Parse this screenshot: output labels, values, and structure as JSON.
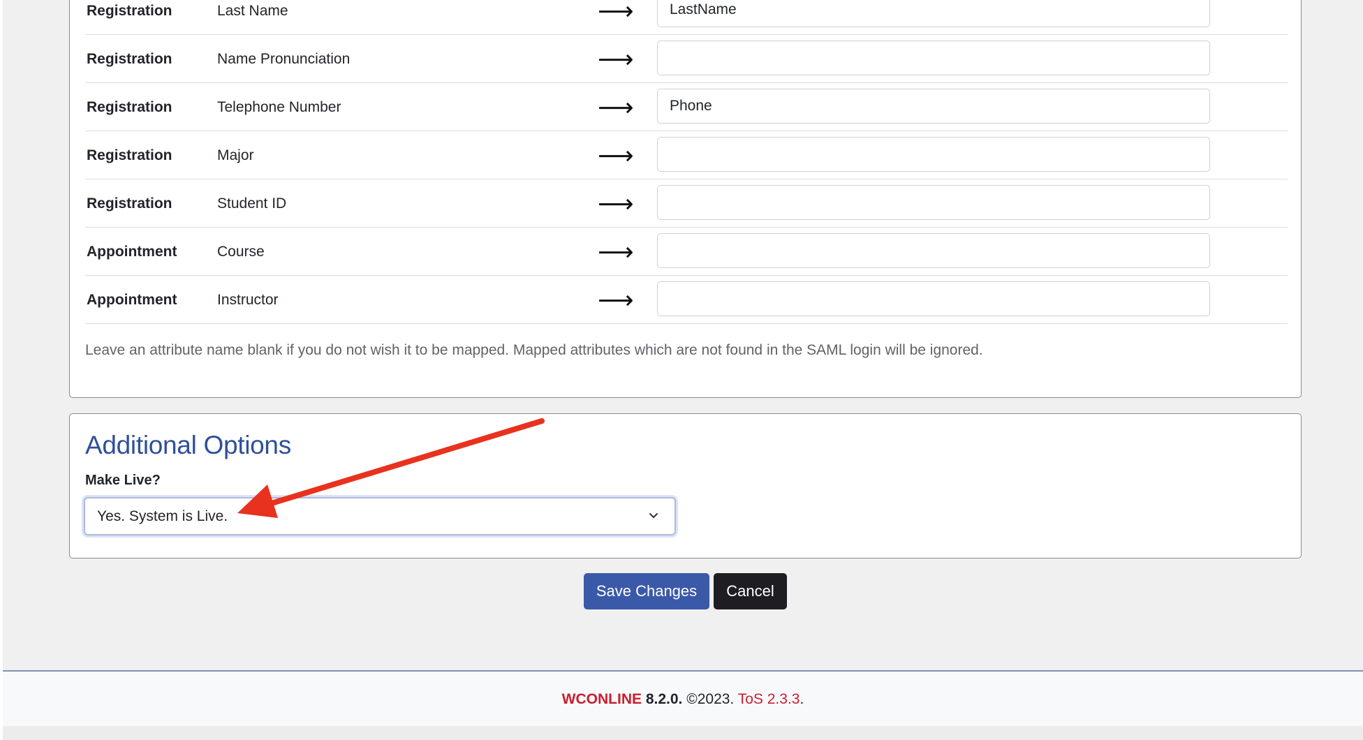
{
  "attribute_mapping": {
    "rows": [
      {
        "category": "Registration",
        "attribute": "Last Name",
        "arrow": "⟶",
        "value": "LastName",
        "placeholder": ""
      },
      {
        "category": "Registration",
        "attribute": "Name Pronunciation",
        "arrow": "⟶",
        "value": "",
        "placeholder": ""
      },
      {
        "category": "Registration",
        "attribute": "Telephone Number",
        "arrow": "⟶",
        "value": "Phone",
        "placeholder": ""
      },
      {
        "category": "Registration",
        "attribute": "Major",
        "arrow": "⟶",
        "value": "",
        "placeholder": ""
      },
      {
        "category": "Registration",
        "attribute": "Student ID",
        "arrow": "⟶",
        "value": "",
        "placeholder": ""
      },
      {
        "category": "Appointment",
        "attribute": "Course",
        "arrow": "⟶",
        "value": "",
        "placeholder": ""
      },
      {
        "category": "Appointment",
        "attribute": "Instructor",
        "arrow": "⟶",
        "value": "",
        "placeholder": ""
      }
    ],
    "help_text": "Leave an attribute name blank if you do not wish it to be mapped. Mapped attributes which are not found in the SAML login will be ignored."
  },
  "additional_options": {
    "title": "Additional Options",
    "make_live_label": "Make Live?",
    "make_live_selected": "Yes. System is Live."
  },
  "actions": {
    "save_label": "Save Changes",
    "cancel_label": "Cancel"
  },
  "footer": {
    "brand": "WCONLINE",
    "version": "8.2.0.",
    "copyright": "©2023.",
    "tos": "ToS 2.3.3",
    "tos_suffix": "."
  },
  "annotation": {
    "arrow_color": "#e8321e"
  },
  "colors": {
    "accent": "#3a59a8",
    "heading": "#2f4f9a",
    "brand_red": "#c8202f",
    "cancel_bg": "#1e1e22"
  }
}
